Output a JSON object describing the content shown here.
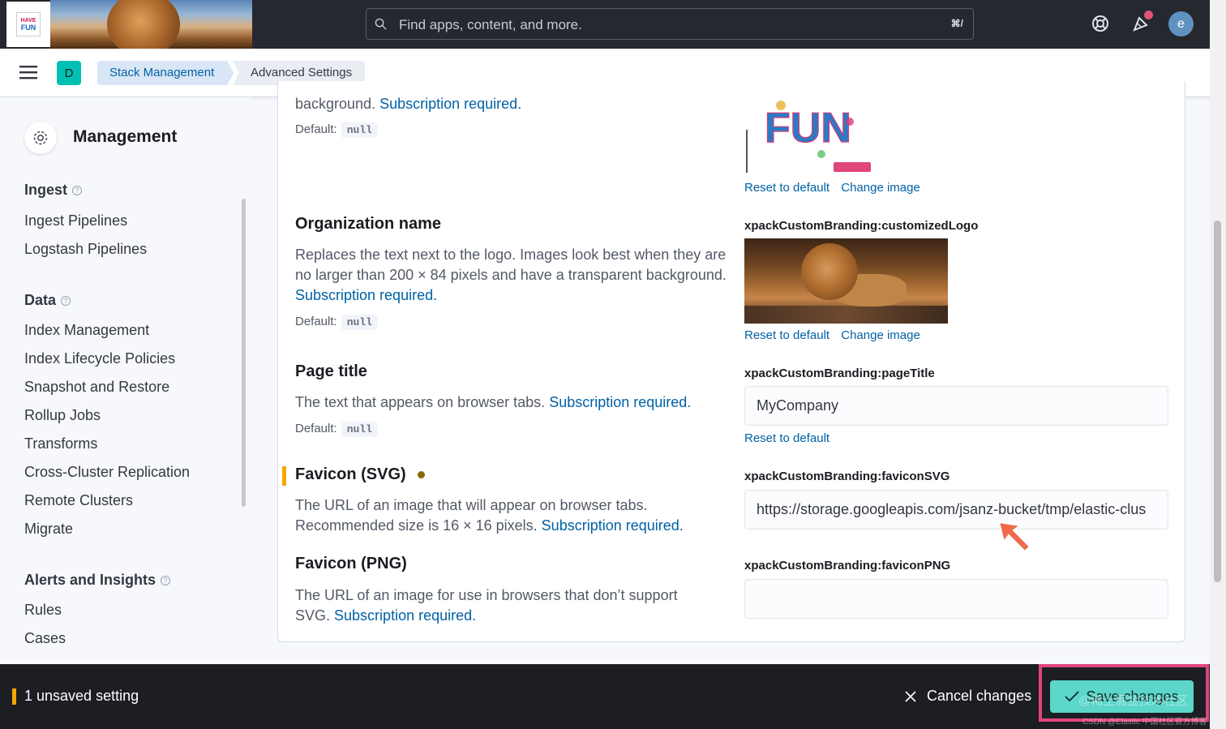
{
  "header": {
    "logo_text_top": "HAVE",
    "logo_text_bottom": "FUN",
    "search_placeholder": "Find apps, content, and more.",
    "search_shortcut": "⌘/",
    "avatar_letter": "e"
  },
  "breadcrumbs": {
    "space_letter": "D",
    "items": [
      "Stack Management",
      "Advanced Settings"
    ]
  },
  "sidebar": {
    "title": "Management",
    "groups": [
      {
        "label": "Ingest",
        "items": [
          "Ingest Pipelines",
          "Logstash Pipelines"
        ]
      },
      {
        "label": "Data",
        "items": [
          "Index Management",
          "Index Lifecycle Policies",
          "Snapshot and Restore",
          "Rollup Jobs",
          "Transforms",
          "Cross-Cluster Replication",
          "Remote Clusters",
          "Migrate"
        ]
      },
      {
        "label": "Alerts and Insights",
        "items": [
          "Rules",
          "Cases"
        ]
      }
    ]
  },
  "settings": {
    "logo_tail": {
      "desc_prefix": "background.",
      "subscription": "Subscription required.",
      "default_label": "Default:",
      "default_value": "null",
      "reset": "Reset to default",
      "change": "Change image",
      "fun_text": "FUN"
    },
    "org_name": {
      "title": "Organization name",
      "desc": "Replaces the text next to the logo. Images look best when they are no larger than 200 × 84 pixels and have a transparent background.",
      "subscription": "Subscription required.",
      "default_label": "Default:",
      "default_value": "null",
      "key": "xpackCustomBranding:customizedLogo",
      "reset": "Reset to default",
      "change": "Change image"
    },
    "page_title": {
      "title": "Page title",
      "desc": "The text that appears on browser tabs.",
      "subscription": "Subscription required.",
      "default_label": "Default:",
      "default_value": "null",
      "key": "xpackCustomBranding:pageTitle",
      "value": "MyCompany",
      "reset": "Reset to default"
    },
    "favicon_svg": {
      "title": "Favicon (SVG)",
      "desc_line1": "The URL of an image that will appear on browser tabs.",
      "desc_line2": "Recommended size is 16 × 16 pixels.",
      "subscription": "Subscription required.",
      "key": "xpackCustomBranding:faviconSVG",
      "value": "https://storage.googleapis.com/jsanz-bucket/tmp/elastic-clus"
    },
    "favicon_png": {
      "title": "Favicon (PNG)",
      "desc_line1": "The URL of an image for use in browsers that don’t support",
      "desc_line2": "SVG.",
      "subscription": "Subscription required.",
      "key": "xpackCustomBranding:faviconPNG",
      "value": ""
    }
  },
  "bottom_bar": {
    "unsaved": "1 unsaved setting",
    "cancel": "Cancel changes",
    "save": "Save changes",
    "watermark1": "@稀土掘金技术社区",
    "watermark2": "CSDN @Elastic 中国社区官方博客"
  },
  "colors": {
    "accent": "#0061a6",
    "save_button": "#5bd6c9",
    "highlight_border": "#e0457b",
    "unsaved_marker": "#f5a700"
  }
}
